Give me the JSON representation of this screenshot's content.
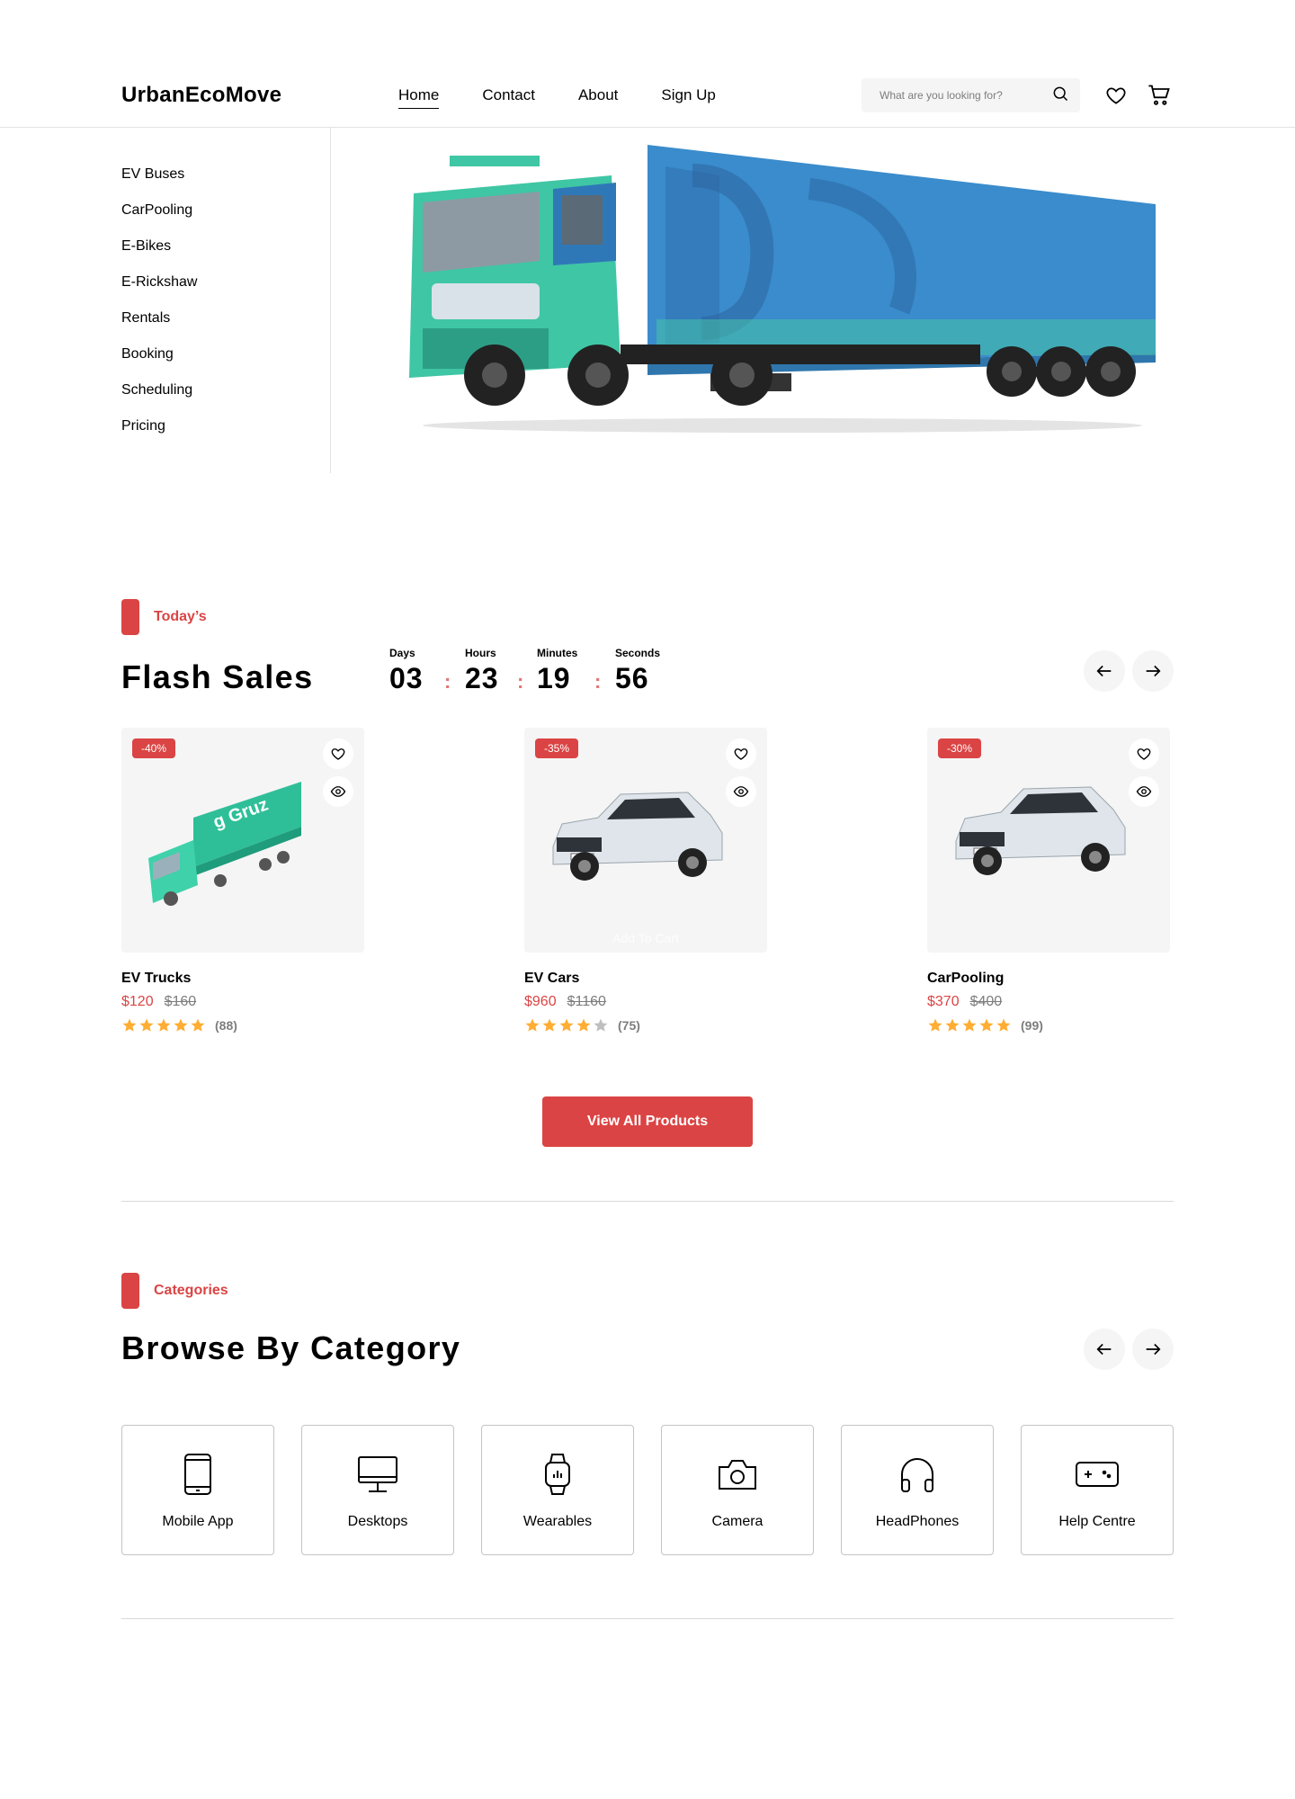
{
  "header": {
    "logo": "UrbanEcoMove",
    "nav": [
      "Home",
      "Contact",
      "About",
      "Sign Up"
    ],
    "search_placeholder": "What are you looking for?"
  },
  "sidebar": {
    "items": [
      "EV Buses",
      "CarPooling",
      "E-Bikes",
      "E-Rickshaw",
      "Rentals",
      "Booking",
      "Scheduling",
      "Pricing"
    ]
  },
  "flash": {
    "tag": "Today’s",
    "title": "Flash Sales",
    "countdown": [
      {
        "label": "Days",
        "value": "03"
      },
      {
        "label": "Hours",
        "value": "23"
      },
      {
        "label": "Minutes",
        "value": "19"
      },
      {
        "label": "Seconds",
        "value": "56"
      }
    ],
    "products": [
      {
        "badge": "-40%",
        "name": "EV Trucks",
        "price": "$120",
        "old_price": "$160",
        "rating": 5,
        "reviews": "(88)",
        "hover_label": ""
      },
      {
        "badge": "-35%",
        "name": "EV Cars",
        "price": "$960",
        "old_price": "$1160",
        "rating": 4,
        "reviews": "(75)",
        "hover_label": "Add To Cart"
      },
      {
        "badge": "-30%",
        "name": "CarPooling",
        "price": "$370",
        "old_price": "$400",
        "rating": 5,
        "reviews": "(99)",
        "hover_label": ""
      }
    ],
    "view_all": "View All Products"
  },
  "categories": {
    "tag": "Categories",
    "title": "Browse By Category",
    "items": [
      {
        "label": "Mobile App",
        "icon": "phone-icon"
      },
      {
        "label": "Desktops",
        "icon": "desktop-icon"
      },
      {
        "label": "Wearables",
        "icon": "smartwatch-icon"
      },
      {
        "label": "Camera",
        "icon": "camera-icon"
      },
      {
        "label": "HeadPhones",
        "icon": "headphones-icon"
      },
      {
        "label": "Help Centre",
        "icon": "gamepad-icon"
      }
    ]
  },
  "colors": {
    "accent": "#db4444",
    "star": "#ffad33",
    "star_empty": "#bfbfbf",
    "card_bg": "#f5f5f5"
  }
}
